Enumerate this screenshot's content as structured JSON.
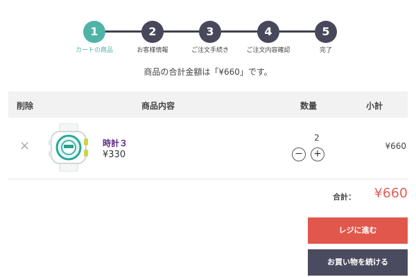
{
  "steps": [
    {
      "num": "1",
      "label": "カートの商品"
    },
    {
      "num": "2",
      "label": "お客様情報"
    },
    {
      "num": "3",
      "label": "ご注文手続き"
    },
    {
      "num": "4",
      "label": "ご注文内容確認"
    },
    {
      "num": "5",
      "label": "完了"
    }
  ],
  "colors": {
    "active": "#4fb3a7",
    "inactive": "#47485a",
    "accent": "#e2574c",
    "dark_button": "#4a4b5e"
  },
  "summary_text": "商品の合計金額は「¥660」です。",
  "table": {
    "headers": {
      "remove": "削除",
      "product": "商品内容",
      "qty": "数量",
      "subtotal": "小計"
    },
    "items": [
      {
        "remove_icon": "×",
        "name": "時計３",
        "price": "¥330",
        "qty": "2",
        "minus": "−",
        "plus": "+",
        "subtotal": "¥660"
      }
    ]
  },
  "total": {
    "label": "合計：",
    "value": "¥660"
  },
  "buttons": {
    "checkout": "レジに進む",
    "continue": "お買い物を続ける"
  }
}
